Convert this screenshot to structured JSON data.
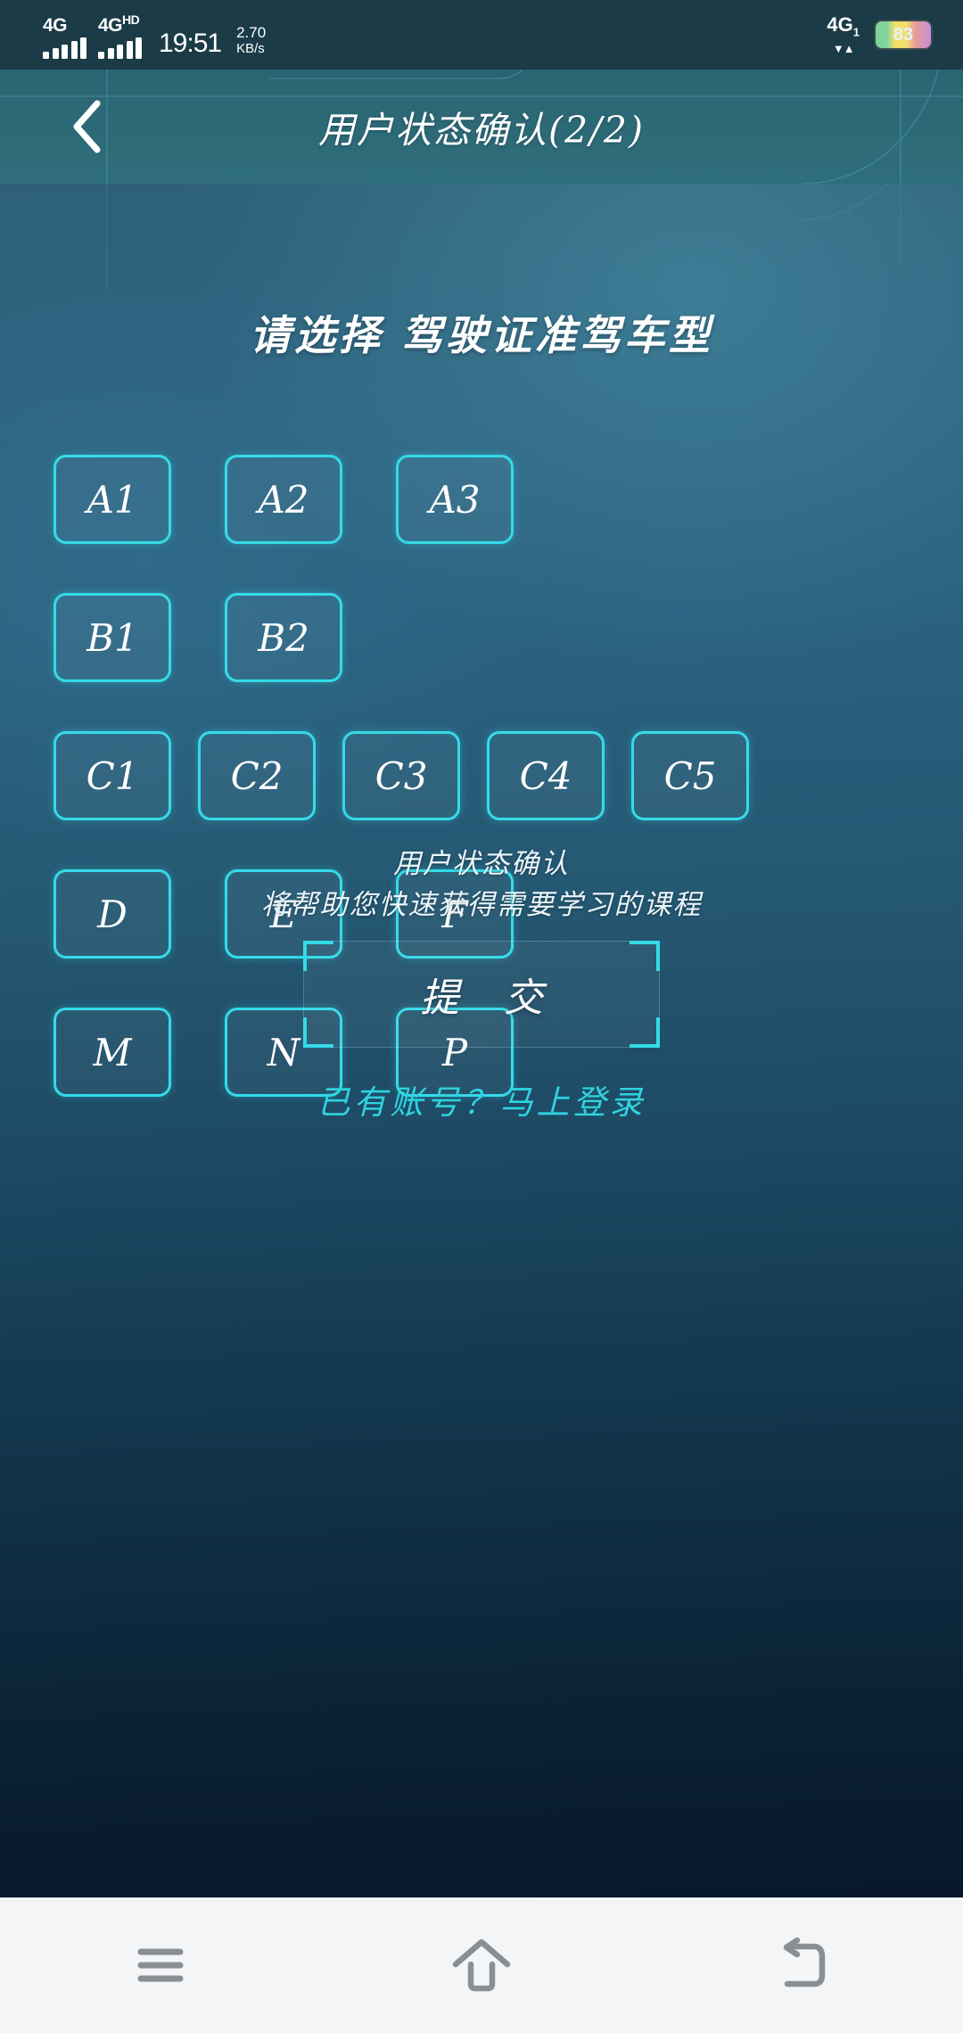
{
  "statusbar": {
    "signal_1_label": "4G",
    "signal_2_label": "4G",
    "signal_2_sup": "HD",
    "time": "19:51",
    "net_speed_value": "2.70",
    "net_speed_unit": "KB/s",
    "right_network_label": "4G",
    "right_network_sub": "1",
    "data_arrows": "▼▲",
    "battery_percent": "83"
  },
  "header": {
    "title": "用户状态确认(2/2)",
    "back_icon": "chevron-left-icon"
  },
  "main": {
    "prompt": "请选择 驾驶证准驾车型",
    "rows": [
      {
        "options": [
          "A1",
          "A2",
          "A3"
        ]
      },
      {
        "options": [
          "B1",
          "B2"
        ]
      },
      {
        "options": [
          "C1",
          "C2",
          "C3",
          "C4",
          "C5"
        ]
      },
      {
        "options": [
          "D",
          "E",
          "F"
        ]
      },
      {
        "options": [
          "M",
          "N",
          "P"
        ]
      }
    ],
    "hint_line_1": "用户状态确认",
    "hint_line_2": "将帮助您快速获得需要学习的课程",
    "submit_label": "提  交",
    "login_link": "已有账号？马上登录"
  },
  "navbar": {
    "recents_icon": "menu-icon",
    "home_icon": "home-icon",
    "back_icon": "back-arrow-icon"
  },
  "colors": {
    "accent_cyan": "#34dbe8",
    "link_cyan": "#2ed3e0",
    "header_teal": "#2d6a78",
    "body_top": "#2d6380",
    "body_bottom": "#08182a",
    "statusbar_bg": "#1b3b47",
    "navbar_bg": "#f4f5f7"
  }
}
